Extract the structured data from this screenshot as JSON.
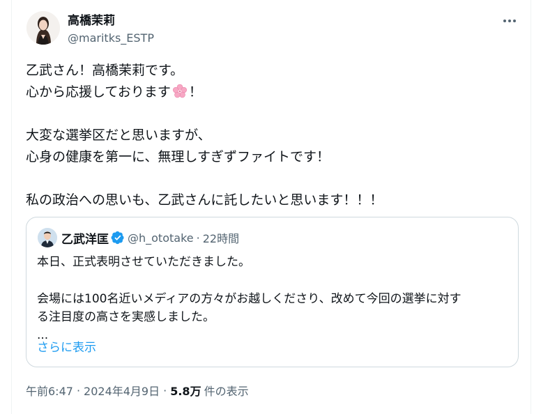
{
  "author": {
    "display_name": "高橋茉莉",
    "handle": "@maritks_ESTP"
  },
  "tweet": {
    "lines": [
      "乙武さん！高橋茉莉です。",
      "心から応援しております",
      "！",
      "大変な選挙区だと思いますが、",
      "心身の健康を第一に、無理しすぎずファイトです！",
      "私の政治への思いも、乙武さんに託したいと思います！！！"
    ],
    "emoji": "cherry-blossom"
  },
  "quoted_tweet": {
    "display_name": "乙武洋匡",
    "handle": "@h_ototake",
    "separator": "·",
    "time": "22時間",
    "lines": [
      "本日、正式表明させていただきました。",
      "会場には100名近いメディアの方々がお越しくださり、改めて今回の選挙に対す",
      "る注目度の高さを実感しました。",
      "..."
    ],
    "show_more": "さらに表示"
  },
  "meta": {
    "time": "午前6:47",
    "separator": "·",
    "date": "2024年4月9日",
    "views_count": "5.8万",
    "views_label": "件の表示"
  },
  "colors": {
    "text": "#0f1419",
    "secondary": "#536471",
    "link": "#1d9bf0",
    "border": "#cfd9de",
    "verified": "#1d9bf0"
  }
}
